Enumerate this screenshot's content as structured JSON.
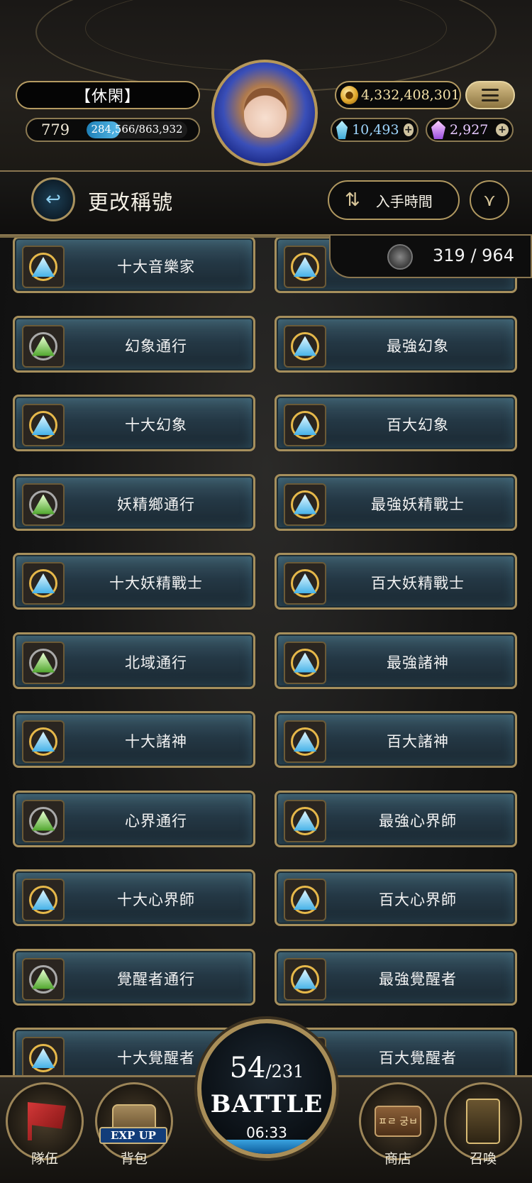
{
  "player": {
    "status_title": "【休閑】",
    "level": "779",
    "exp_text": "284,566/863,932",
    "exp_fraction": 0.33,
    "gold": "4,332,408,301",
    "crystal": "10,493",
    "jewel": "2,927"
  },
  "header": {
    "page_title": "更改稱號",
    "sort_label": "入手時間"
  },
  "counter": "319 / 964",
  "titles": [
    {
      "label": "十大音樂家",
      "tier": "gold"
    },
    {
      "label": "",
      "tier": "gold"
    },
    {
      "label": "幻象通行",
      "tier": "silver"
    },
    {
      "label": "最強幻象",
      "tier": "gold"
    },
    {
      "label": "十大幻象",
      "tier": "gold"
    },
    {
      "label": "百大幻象",
      "tier": "gold"
    },
    {
      "label": "妖精鄉通行",
      "tier": "silver"
    },
    {
      "label": "最強妖精戰士",
      "tier": "gold"
    },
    {
      "label": "十大妖精戰士",
      "tier": "gold"
    },
    {
      "label": "百大妖精戰士",
      "tier": "gold"
    },
    {
      "label": "北域通行",
      "tier": "silver"
    },
    {
      "label": "最強諸神",
      "tier": "gold"
    },
    {
      "label": "十大諸神",
      "tier": "gold"
    },
    {
      "label": "百大諸神",
      "tier": "gold"
    },
    {
      "label": "心界通行",
      "tier": "silver"
    },
    {
      "label": "最強心界師",
      "tier": "gold"
    },
    {
      "label": "十大心界師",
      "tier": "gold"
    },
    {
      "label": "百大心界師",
      "tier": "gold"
    },
    {
      "label": "覺醒者通行",
      "tier": "silver"
    },
    {
      "label": "最強覺醒者",
      "tier": "gold"
    },
    {
      "label": "十大覺醒者",
      "tier": "gold"
    },
    {
      "label": "百大覺醒者",
      "tier": "gold"
    }
  ],
  "battle": {
    "stamina_current": "54",
    "stamina_max": "/231",
    "label": "BATTLE",
    "timer": "06:33"
  },
  "nav": {
    "team": "隊伍",
    "bag": "背包",
    "bag_tag": "EXP UP",
    "shop": "商店",
    "shop_sign": "ㅍㄹ 궁ㅂ",
    "summon": "召喚"
  },
  "colors": {
    "frame_gold": "#a68f5c",
    "panel_teal": "#243845",
    "exp_blue": "#57b9e8"
  }
}
